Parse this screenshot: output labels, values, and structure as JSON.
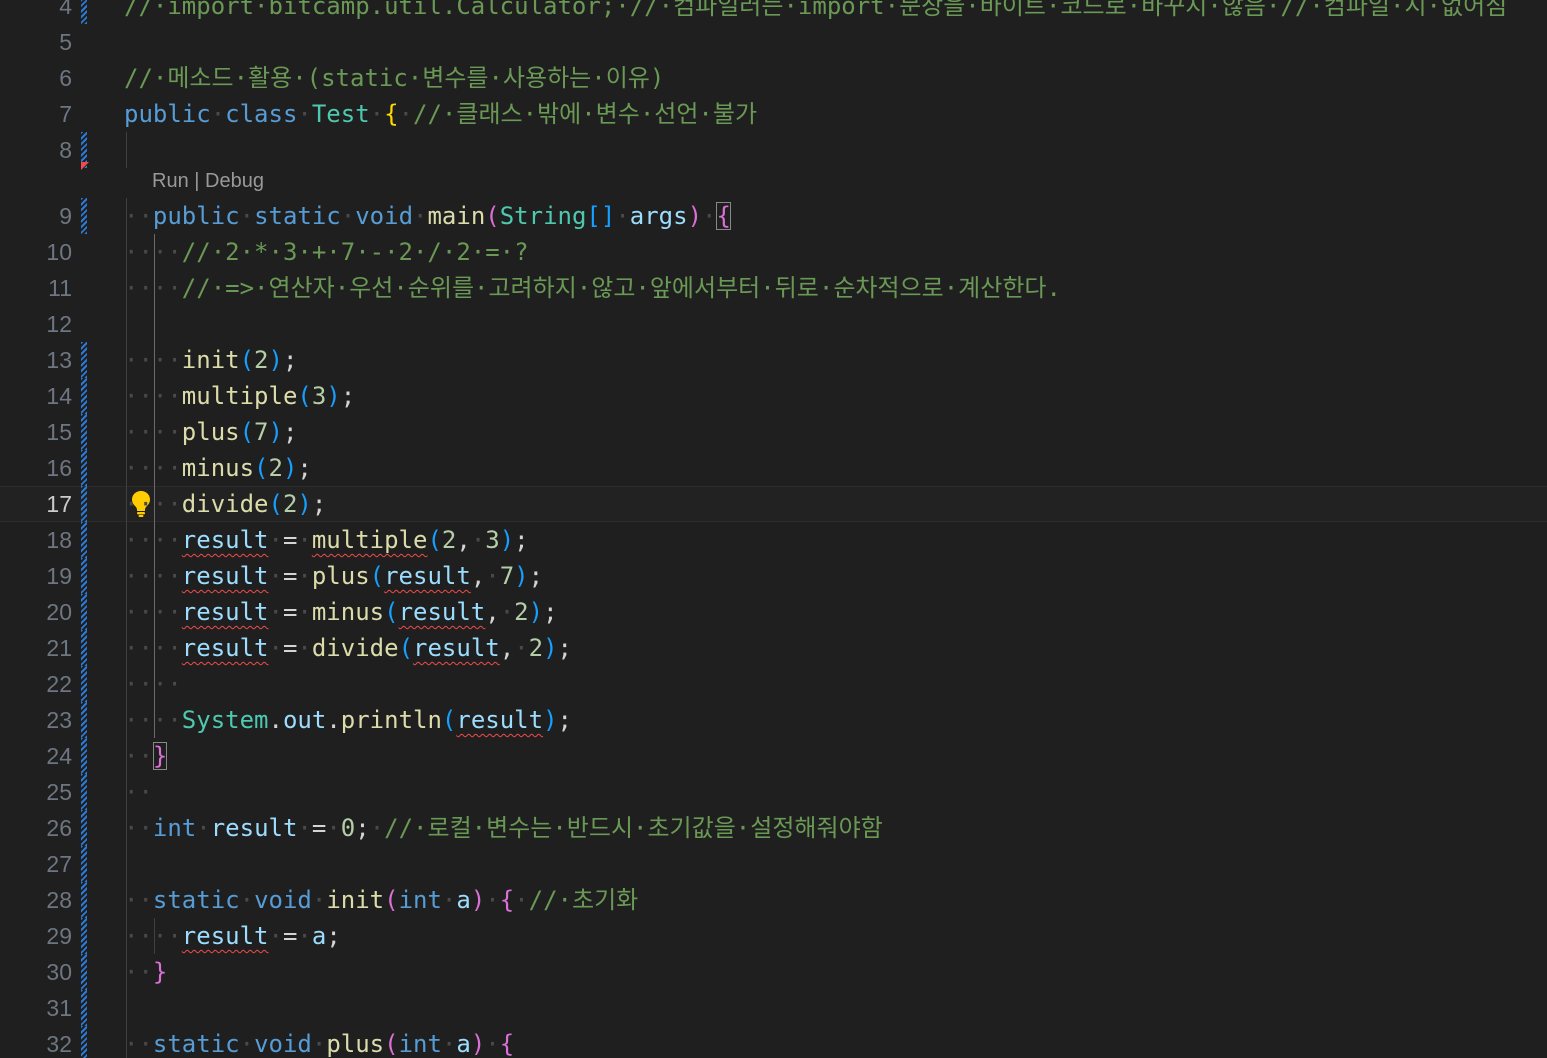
{
  "editor": {
    "language": "java",
    "current_line": 17,
    "codelens": {
      "run": "Run",
      "separator": " | ",
      "debug": "Debug"
    },
    "colors": {
      "background": "#1f1f1f",
      "keyword": "#569cd6",
      "type": "#4ec9b0",
      "function": "#dcdcaa",
      "variable": "#9cdcfe",
      "number": "#b5cea8",
      "comment": "#6a9955",
      "bracket_gold": "#ffd700",
      "bracket_pink": "#da70d6",
      "bracket_blue": "#179fff",
      "error_squiggle": "#f14c4c",
      "modified_gutter": "#2b7ad6"
    },
    "lines": [
      {
        "number": "4",
        "modified": true,
        "tokens": [
          {
            "t": "//·import·bitcamp.util.Calculator;·//·컴파일러는·import·문장을·바이트·코드로·바꾸지·않음·//·컴파일·시·없어짐",
            "c": "cm"
          }
        ]
      },
      {
        "number": "5",
        "tokens": []
      },
      {
        "number": "6",
        "tokens": [
          {
            "t": "//·메소드·활용·(static·변수를·사용하는·이유)",
            "c": "cm"
          }
        ]
      },
      {
        "number": "7",
        "tokens": [
          {
            "t": "public",
            "c": "kw"
          },
          {
            "t": "·",
            "c": "ws"
          },
          {
            "t": "class",
            "c": "kw"
          },
          {
            "t": "·",
            "c": "ws"
          },
          {
            "t": "Test",
            "c": "ty"
          },
          {
            "t": "·",
            "c": "ws"
          },
          {
            "t": "{",
            "c": "b1"
          },
          {
            "t": "·",
            "c": "ws"
          },
          {
            "t": "//·클래스·밖에·변수·선언·불가",
            "c": "cm"
          }
        ]
      },
      {
        "number": "8",
        "modified": true,
        "deleted_marker": true,
        "tokens": []
      },
      {
        "number": "9",
        "modified": true,
        "tokens": [
          {
            "t": "··",
            "c": "ws"
          },
          {
            "t": "public",
            "c": "kw"
          },
          {
            "t": "·",
            "c": "ws"
          },
          {
            "t": "static",
            "c": "kw"
          },
          {
            "t": "·",
            "c": "ws"
          },
          {
            "t": "void",
            "c": "kw"
          },
          {
            "t": "·",
            "c": "ws"
          },
          {
            "t": "main",
            "c": "fn"
          },
          {
            "t": "(",
            "c": "b2"
          },
          {
            "t": "String",
            "c": "ty"
          },
          {
            "t": "[]",
            "c": "b3"
          },
          {
            "t": "·",
            "c": "ws"
          },
          {
            "t": "args",
            "c": "vr"
          },
          {
            "t": ")",
            "c": "b2"
          },
          {
            "t": "·",
            "c": "ws"
          },
          {
            "t": "{",
            "c": "b2",
            "m": true
          }
        ]
      },
      {
        "number": "10",
        "tokens": [
          {
            "t": "····",
            "c": "ws"
          },
          {
            "t": "//·2·*·3·+·7·-·2·/·2·=·?",
            "c": "cm"
          }
        ]
      },
      {
        "number": "11",
        "tokens": [
          {
            "t": "····",
            "c": "ws"
          },
          {
            "t": "//·=>·연산자·우선·순위를·고려하지·않고·앞에서부터·뒤로·순차적으로·계산한다.",
            "c": "cm"
          }
        ]
      },
      {
        "number": "12",
        "tokens": []
      },
      {
        "number": "13",
        "modified": true,
        "tokens": [
          {
            "t": "····",
            "c": "ws"
          },
          {
            "t": "init",
            "c": "fn"
          },
          {
            "t": "(",
            "c": "b3"
          },
          {
            "t": "2",
            "c": "nm"
          },
          {
            "t": ")",
            "c": "b3"
          },
          {
            "t": ";",
            "c": "pl"
          }
        ]
      },
      {
        "number": "14",
        "modified": true,
        "tokens": [
          {
            "t": "····",
            "c": "ws"
          },
          {
            "t": "multiple",
            "c": "fn"
          },
          {
            "t": "(",
            "c": "b3"
          },
          {
            "t": "3",
            "c": "nm"
          },
          {
            "t": ")",
            "c": "b3"
          },
          {
            "t": ";",
            "c": "pl"
          }
        ]
      },
      {
        "number": "15",
        "modified": true,
        "tokens": [
          {
            "t": "····",
            "c": "ws"
          },
          {
            "t": "plus",
            "c": "fn"
          },
          {
            "t": "(",
            "c": "b3"
          },
          {
            "t": "7",
            "c": "nm"
          },
          {
            "t": ")",
            "c": "b3"
          },
          {
            "t": ";",
            "c": "pl"
          }
        ]
      },
      {
        "number": "16",
        "modified": true,
        "tokens": [
          {
            "t": "····",
            "c": "ws"
          },
          {
            "t": "minus",
            "c": "fn"
          },
          {
            "t": "(",
            "c": "b3"
          },
          {
            "t": "2",
            "c": "nm"
          },
          {
            "t": ")",
            "c": "b3"
          },
          {
            "t": ";",
            "c": "pl"
          }
        ]
      },
      {
        "number": "17",
        "modified": true,
        "lightbulb": true,
        "tokens": [
          {
            "t": "····",
            "c": "ws"
          },
          {
            "t": "divide",
            "c": "fn"
          },
          {
            "t": "(",
            "c": "b3"
          },
          {
            "t": "2",
            "c": "nm"
          },
          {
            "t": ")",
            "c": "b3"
          },
          {
            "t": ";",
            "c": "pl"
          }
        ]
      },
      {
        "number": "18",
        "modified": true,
        "tokens": [
          {
            "t": "····",
            "c": "ws"
          },
          {
            "t": "result",
            "c": "vr",
            "e": true
          },
          {
            "t": "·",
            "c": "ws"
          },
          {
            "t": "=",
            "c": "op"
          },
          {
            "t": "·",
            "c": "ws"
          },
          {
            "t": "multiple",
            "c": "fn",
            "e": true
          },
          {
            "t": "(",
            "c": "b3"
          },
          {
            "t": "2",
            "c": "nm"
          },
          {
            "t": ",",
            "c": "pl"
          },
          {
            "t": "·",
            "c": "ws"
          },
          {
            "t": "3",
            "c": "nm"
          },
          {
            "t": ")",
            "c": "b3"
          },
          {
            "t": ";",
            "c": "pl"
          }
        ]
      },
      {
        "number": "19",
        "modified": true,
        "tokens": [
          {
            "t": "····",
            "c": "ws"
          },
          {
            "t": "result",
            "c": "vr",
            "e": true
          },
          {
            "t": "·",
            "c": "ws"
          },
          {
            "t": "=",
            "c": "op"
          },
          {
            "t": "·",
            "c": "ws"
          },
          {
            "t": "plus",
            "c": "fn"
          },
          {
            "t": "(",
            "c": "b3"
          },
          {
            "t": "result",
            "c": "vr",
            "e": true
          },
          {
            "t": ",",
            "c": "pl"
          },
          {
            "t": "·",
            "c": "ws"
          },
          {
            "t": "7",
            "c": "nm"
          },
          {
            "t": ")",
            "c": "b3"
          },
          {
            "t": ";",
            "c": "pl"
          }
        ]
      },
      {
        "number": "20",
        "modified": true,
        "tokens": [
          {
            "t": "····",
            "c": "ws"
          },
          {
            "t": "result",
            "c": "vr",
            "e": true
          },
          {
            "t": "·",
            "c": "ws"
          },
          {
            "t": "=",
            "c": "op"
          },
          {
            "t": "·",
            "c": "ws"
          },
          {
            "t": "minus",
            "c": "fn"
          },
          {
            "t": "(",
            "c": "b3"
          },
          {
            "t": "result",
            "c": "vr",
            "e": true
          },
          {
            "t": ",",
            "c": "pl"
          },
          {
            "t": "·",
            "c": "ws"
          },
          {
            "t": "2",
            "c": "nm"
          },
          {
            "t": ")",
            "c": "b3"
          },
          {
            "t": ";",
            "c": "pl"
          }
        ]
      },
      {
        "number": "21",
        "modified": true,
        "tokens": [
          {
            "t": "····",
            "c": "ws"
          },
          {
            "t": "result",
            "c": "vr",
            "e": true
          },
          {
            "t": "·",
            "c": "ws"
          },
          {
            "t": "=",
            "c": "op"
          },
          {
            "t": "·",
            "c": "ws"
          },
          {
            "t": "divide",
            "c": "fn"
          },
          {
            "t": "(",
            "c": "b3"
          },
          {
            "t": "result",
            "c": "vr",
            "e": true
          },
          {
            "t": ",",
            "c": "pl"
          },
          {
            "t": "·",
            "c": "ws"
          },
          {
            "t": "2",
            "c": "nm"
          },
          {
            "t": ")",
            "c": "b3"
          },
          {
            "t": ";",
            "c": "pl"
          }
        ]
      },
      {
        "number": "22",
        "modified": true,
        "tokens": [
          {
            "t": "····",
            "c": "ws"
          }
        ]
      },
      {
        "number": "23",
        "modified": true,
        "tokens": [
          {
            "t": "····",
            "c": "ws"
          },
          {
            "t": "System",
            "c": "ty"
          },
          {
            "t": ".",
            "c": "pl"
          },
          {
            "t": "out",
            "c": "vr"
          },
          {
            "t": ".",
            "c": "pl"
          },
          {
            "t": "println",
            "c": "fn"
          },
          {
            "t": "(",
            "c": "b3"
          },
          {
            "t": "result",
            "c": "vr",
            "e": true
          },
          {
            "t": ")",
            "c": "b3"
          },
          {
            "t": ";",
            "c": "pl"
          }
        ]
      },
      {
        "number": "24",
        "modified": true,
        "tokens": [
          {
            "t": "··",
            "c": "ws"
          },
          {
            "t": "}",
            "c": "b2",
            "m": true
          }
        ]
      },
      {
        "number": "25",
        "modified": true,
        "tokens": [
          {
            "t": "··",
            "c": "ws"
          }
        ]
      },
      {
        "number": "26",
        "modified": true,
        "tokens": [
          {
            "t": "··",
            "c": "ws"
          },
          {
            "t": "int",
            "c": "kw"
          },
          {
            "t": "·",
            "c": "ws"
          },
          {
            "t": "result",
            "c": "vr"
          },
          {
            "t": "·",
            "c": "ws"
          },
          {
            "t": "=",
            "c": "op"
          },
          {
            "t": "·",
            "c": "ws"
          },
          {
            "t": "0",
            "c": "nm"
          },
          {
            "t": ";",
            "c": "pl"
          },
          {
            "t": "·",
            "c": "ws"
          },
          {
            "t": "//·로컬·변수는·반드시·초기값을·설정해줘야함",
            "c": "cm"
          }
        ]
      },
      {
        "number": "27",
        "modified": true,
        "tokens": []
      },
      {
        "number": "28",
        "modified": true,
        "tokens": [
          {
            "t": "··",
            "c": "ws"
          },
          {
            "t": "static",
            "c": "kw"
          },
          {
            "t": "·",
            "c": "ws"
          },
          {
            "t": "void",
            "c": "kw"
          },
          {
            "t": "·",
            "c": "ws"
          },
          {
            "t": "init",
            "c": "fn"
          },
          {
            "t": "(",
            "c": "b2"
          },
          {
            "t": "int",
            "c": "kw"
          },
          {
            "t": "·",
            "c": "ws"
          },
          {
            "t": "a",
            "c": "vr"
          },
          {
            "t": ")",
            "c": "b2"
          },
          {
            "t": "·",
            "c": "ws"
          },
          {
            "t": "{",
            "c": "b2"
          },
          {
            "t": "·",
            "c": "ws"
          },
          {
            "t": "//·초기화",
            "c": "cm"
          }
        ]
      },
      {
        "number": "29",
        "modified": true,
        "tokens": [
          {
            "t": "····",
            "c": "ws"
          },
          {
            "t": "result",
            "c": "vr",
            "e": true
          },
          {
            "t": "·",
            "c": "ws"
          },
          {
            "t": "=",
            "c": "op"
          },
          {
            "t": "·",
            "c": "ws"
          },
          {
            "t": "a",
            "c": "vr"
          },
          {
            "t": ";",
            "c": "pl"
          }
        ]
      },
      {
        "number": "30",
        "modified": true,
        "tokens": [
          {
            "t": "··",
            "c": "ws"
          },
          {
            "t": "}",
            "c": "b2"
          }
        ]
      },
      {
        "number": "31",
        "modified": true,
        "tokens": []
      },
      {
        "number": "32",
        "modified": true,
        "tokens": [
          {
            "t": "··",
            "c": "ws"
          },
          {
            "t": "static",
            "c": "kw"
          },
          {
            "t": "·",
            "c": "ws"
          },
          {
            "t": "void",
            "c": "kw"
          },
          {
            "t": "·",
            "c": "ws"
          },
          {
            "t": "plus",
            "c": "fn"
          },
          {
            "t": "(",
            "c": "b2"
          },
          {
            "t": "int",
            "c": "kw"
          },
          {
            "t": "·",
            "c": "ws"
          },
          {
            "t": "a",
            "c": "vr"
          },
          {
            "t": ")",
            "c": "b2"
          },
          {
            "t": "·",
            "c": "ws"
          },
          {
            "t": "{",
            "c": "b2"
          }
        ]
      }
    ]
  }
}
